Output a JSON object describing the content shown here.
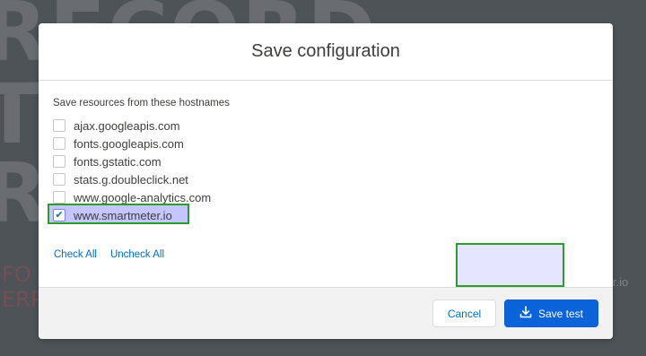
{
  "modal": {
    "title": "Save configuration",
    "section_label": "Save resources from these hostnames",
    "hostnames": [
      {
        "label": "ajax.googleapis.com",
        "checked": false
      },
      {
        "label": "fonts.googleapis.com",
        "checked": false
      },
      {
        "label": "fonts.gstatic.com",
        "checked": false
      },
      {
        "label": "stats.g.doubleclick.net",
        "checked": false
      },
      {
        "label": "www.google-analytics.com",
        "checked": false
      },
      {
        "label": "www.smartmeter.io",
        "checked": true
      }
    ],
    "check_all_label": "Check All",
    "uncheck_all_label": "Uncheck All",
    "cancel_label": "Cancel",
    "save_label": "Save test"
  },
  "background": {
    "big_text": [
      "RECORD",
      "TE",
      "RE",
      "E"
    ],
    "red_text": [
      "FO",
      "ERP"
    ],
    "right_text": "ter.io"
  },
  "colors": {
    "primary": "#0b63d9",
    "link": "#006dcc",
    "highlight_border": "#2e9b2e"
  }
}
